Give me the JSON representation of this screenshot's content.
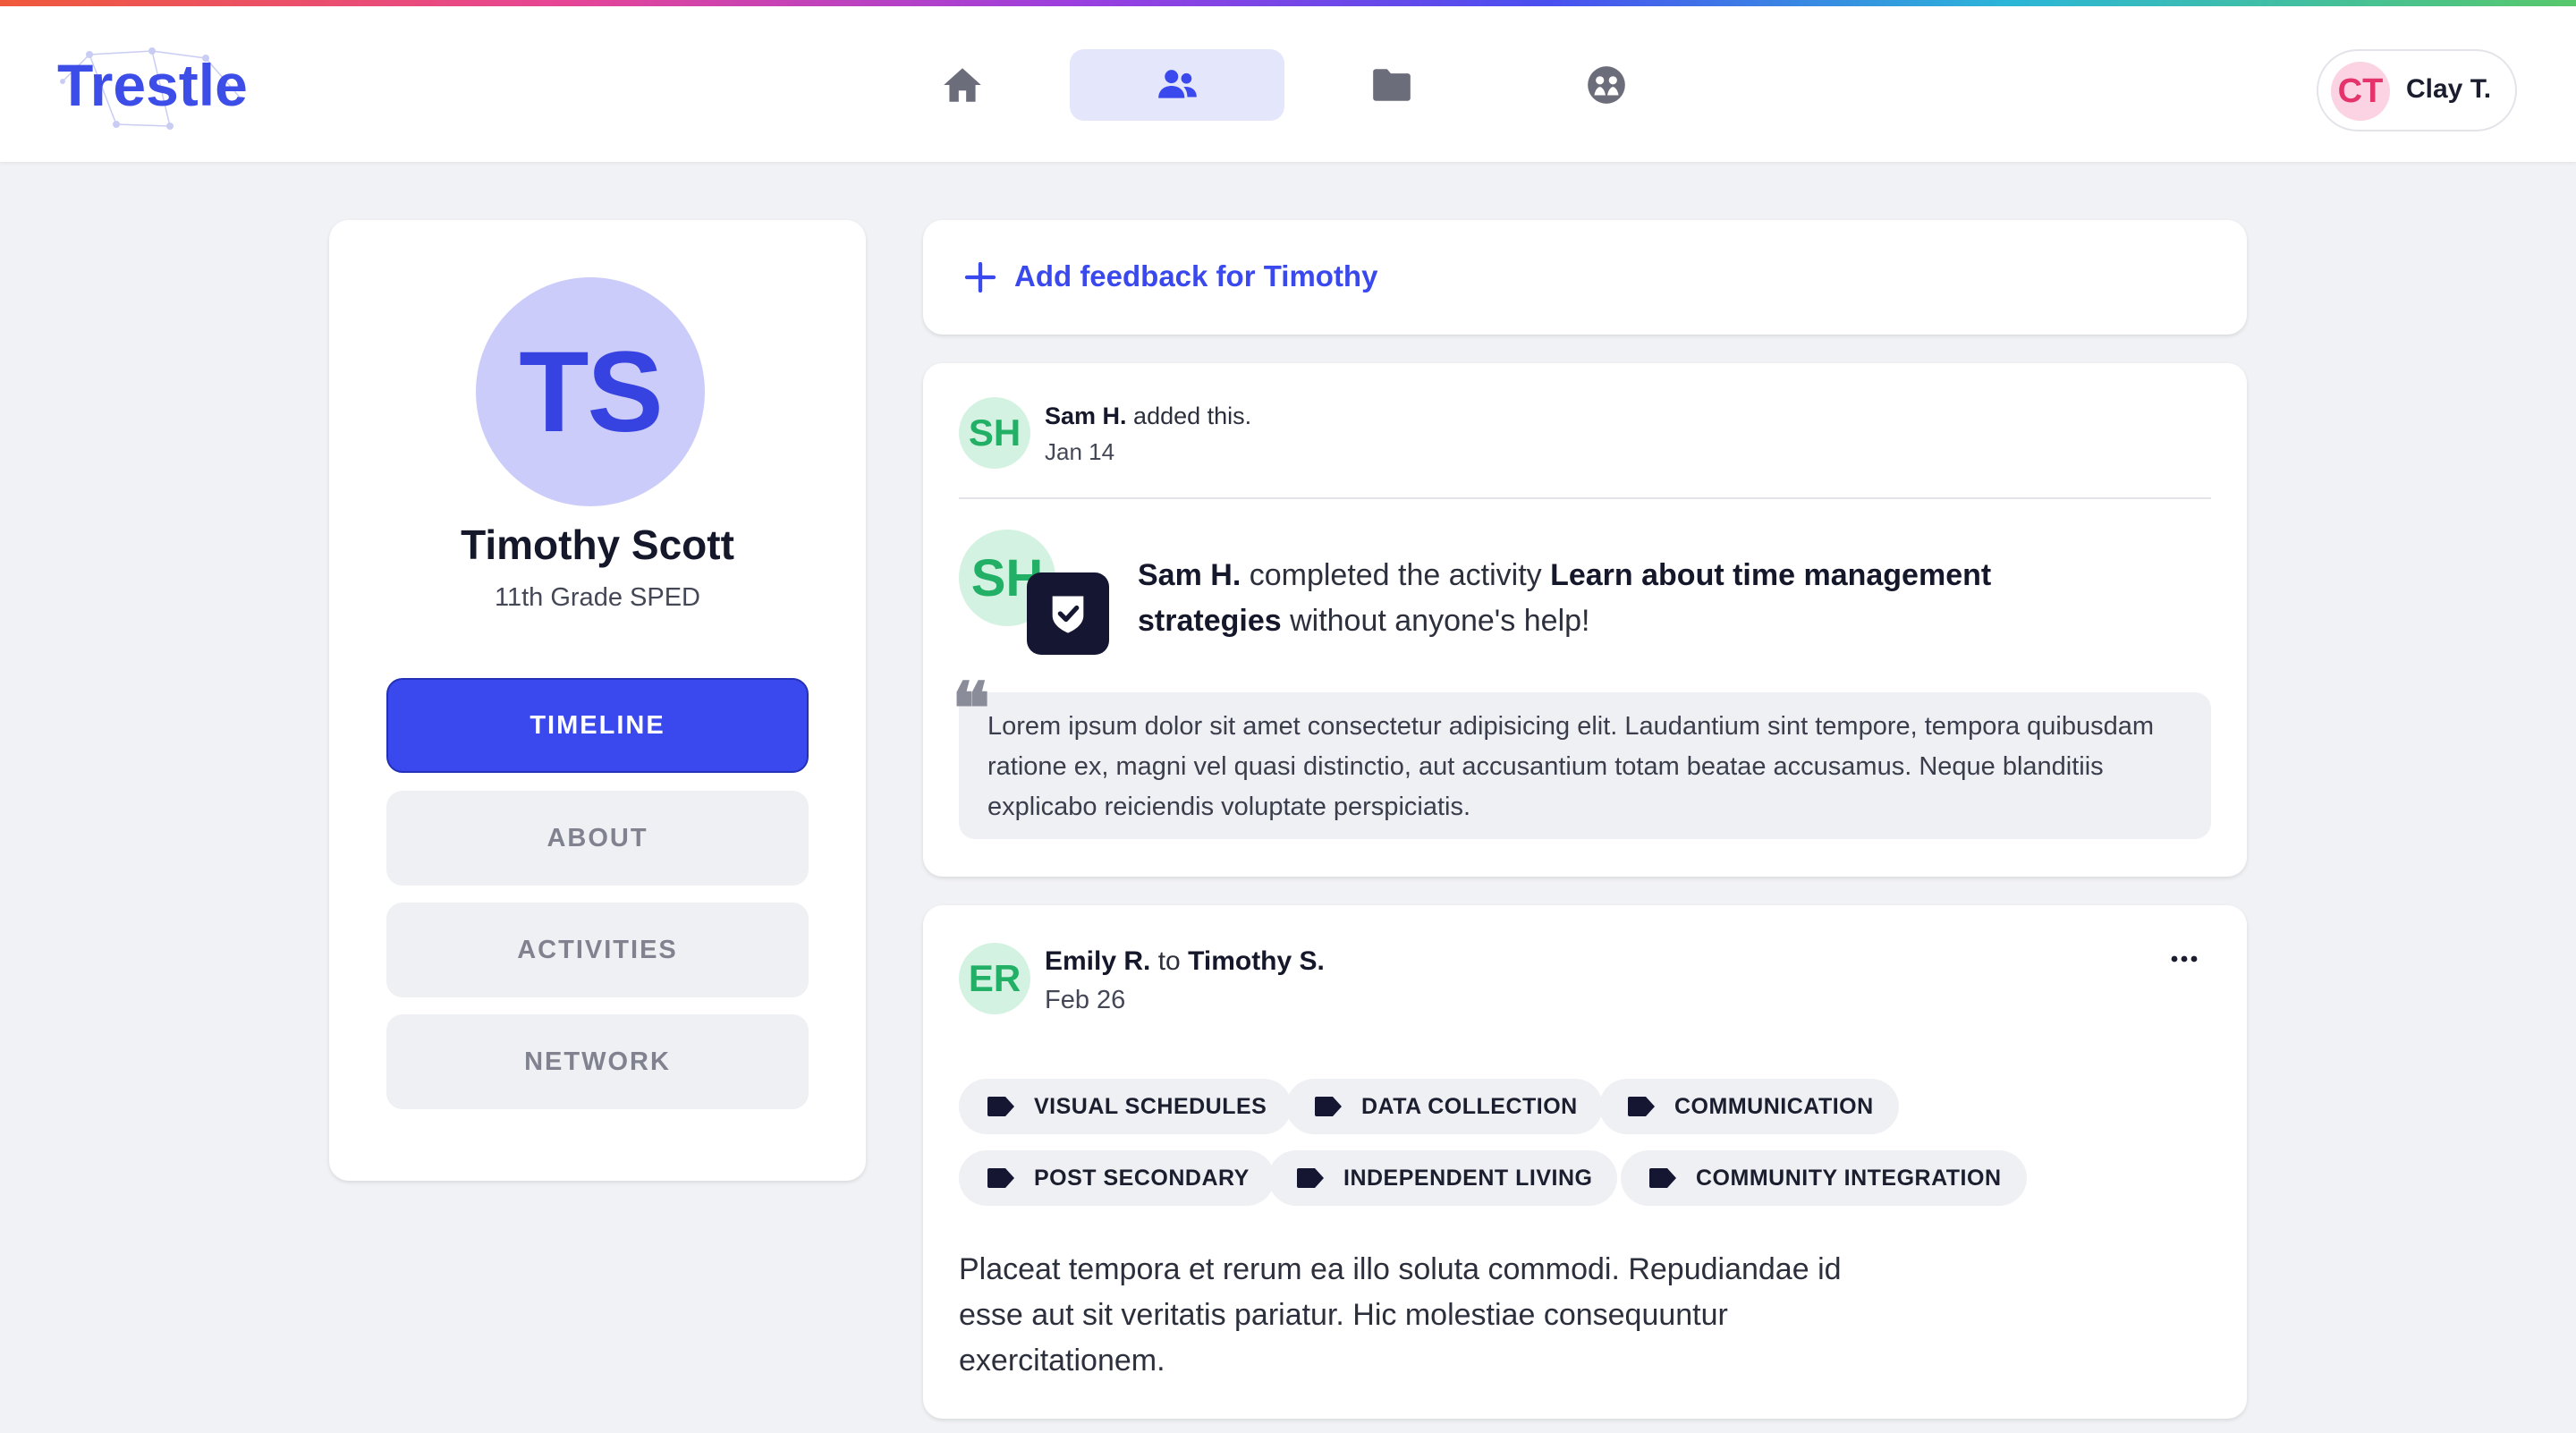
{
  "app": {
    "name": "Trestle"
  },
  "colors": {
    "accent": "#3a49ee",
    "green": "#22b066",
    "pink": "#e5336c"
  },
  "nav": [
    {
      "icon": "home-icon",
      "active": false
    },
    {
      "icon": "people-icon",
      "active": true
    },
    {
      "icon": "folder-icon",
      "active": false
    },
    {
      "icon": "community-icon",
      "active": false
    }
  ],
  "user": {
    "initials": "CT",
    "name": "Clay T."
  },
  "profile": {
    "initials": "TS",
    "name": "Timothy Scott",
    "subtitle": "11th Grade SPED",
    "menu": [
      {
        "label": "TIMELINE",
        "active": true
      },
      {
        "label": "ABOUT",
        "active": false
      },
      {
        "label": "ACTIVITIES",
        "active": false
      },
      {
        "label": "NETWORK",
        "active": false
      }
    ]
  },
  "add_feedback": {
    "label": "Add feedback for Timothy"
  },
  "activity_post": {
    "author_initials": "SH",
    "author": "Sam H.",
    "action": " added this.",
    "date": "Jan 14",
    "actor": "Sam H.",
    "text_pre": " completed the activity ",
    "activity": "Learn about time management strategies",
    "text_post": " without anyone's help!",
    "quote_mark": "❝",
    "quote": "Lorem ipsum dolor sit amet consectetur adipisicing elit. Laudantium sint tempore, tempora quibusdam ratione ex, magni vel quasi distinctio, aut accusantium totam beatae accusamus. Neque blanditiis explicabo reiciendis voluptate perspiciatis."
  },
  "feedback_post": {
    "author_initials": "ER",
    "author": "Emily R.",
    "connector": " to ",
    "recipient": "Timothy S.",
    "date": "Feb 26",
    "tags": [
      "VISUAL SCHEDULES",
      "DATA COLLECTION",
      "COMMUNICATION",
      "POST SECONDARY",
      "INDEPENDENT LIVING",
      "COMMUNITY INTEGRATION"
    ],
    "body": "Placeat tempora et rerum ea illo soluta commodi. Repudiandae id esse aut sit veritatis pariatur. Hic molestiae consequuntur exercitationem."
  }
}
